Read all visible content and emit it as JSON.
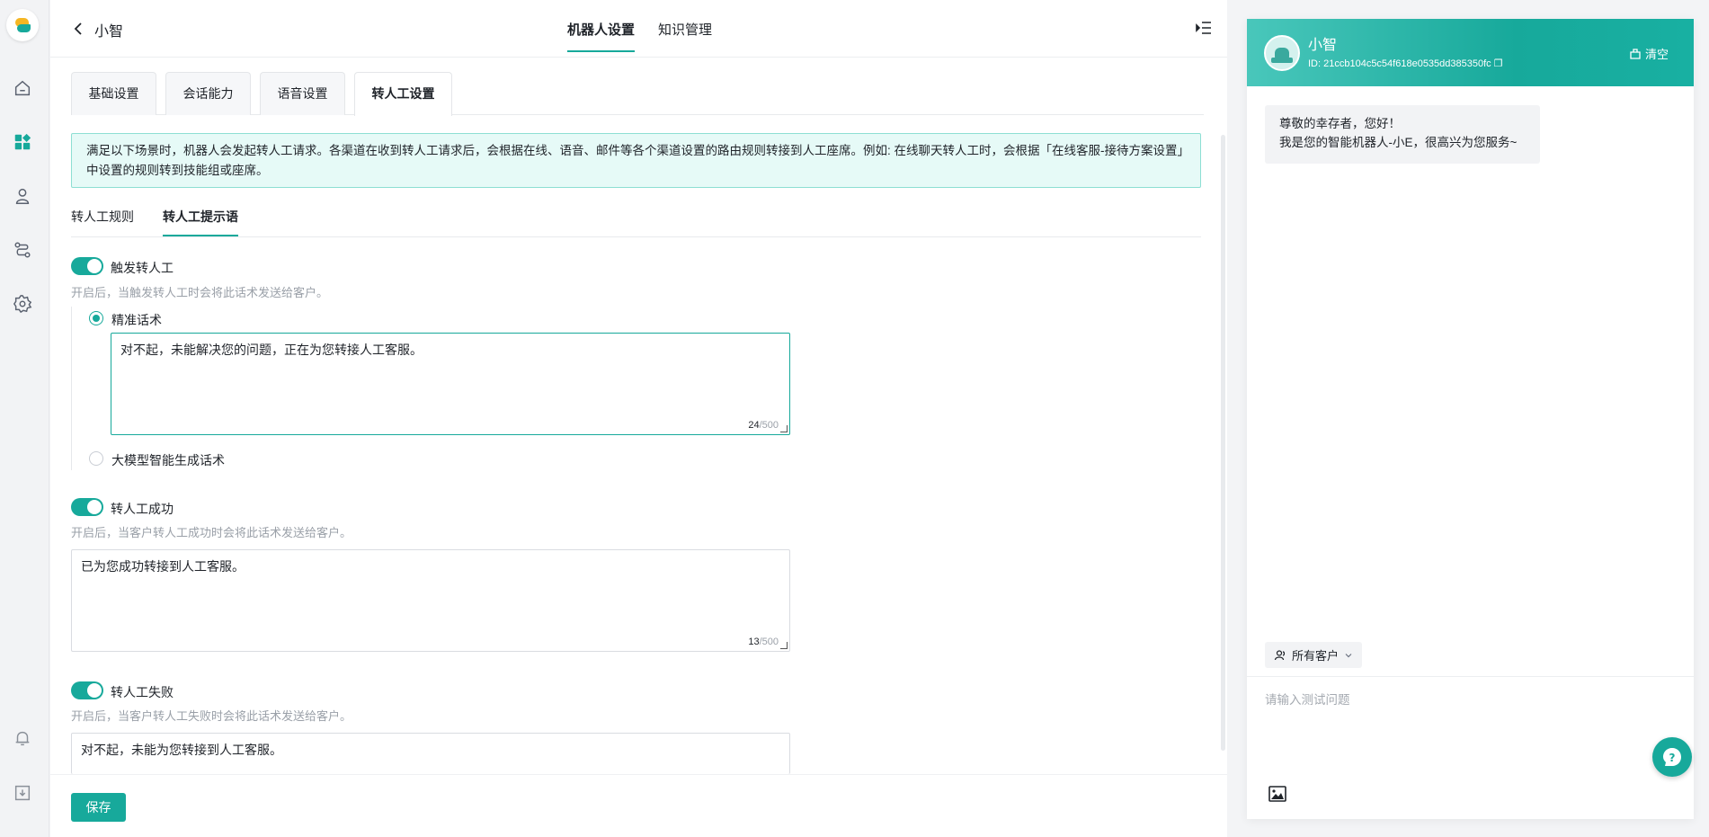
{
  "app": {
    "bot_name": "小智",
    "top_tabs": [
      "机器人设置",
      "知识管理"
    ],
    "top_active_tab": "机器人设置"
  },
  "subtabs": [
    "基础设置",
    "会话能力",
    "语音设置",
    "转人工设置"
  ],
  "notice": "满足以下场景时，机器人会发起转人工请求。各渠道在收到转人工请求后，会根据在线、语音、邮件等各个渠道设置的路由规则转接到人工座席。例如: 在线聊天转人工时，会根据「在线客服-接待方案设置」中设置的规则转到技能组或座席。",
  "inner_tabs": [
    "转人工规则",
    "转人工提示语"
  ],
  "trigger": {
    "title": "触发转人工",
    "enabled": true,
    "hint": "开启后，当触发转人工时会将此话术发送给客户。",
    "option1": "精准话术",
    "option2": "大模型智能生成话术",
    "text": "对不起，未能解决您的问题，正在为您转接人工客服。",
    "count": "24",
    "max": "/500"
  },
  "success": {
    "title": "转人工成功",
    "enabled": true,
    "hint": "开启后，当客户转人工成功时会将此话术发送给客户。",
    "text": "已为您成功转接到人工客服。",
    "count": "13",
    "max": "/500"
  },
  "fail": {
    "title": "转人工失败",
    "enabled": true,
    "hint": "开启后，当客户转人工失败时会将此话术发送给客户。",
    "text": "对不起，未能为您转接到人工客服。"
  },
  "footer": {
    "save_label": "保存"
  },
  "chat": {
    "name": "小智",
    "id": "ID: 21ccb104c5c54f618e0535dd385350fc",
    "clear_label": "清空",
    "greeting_line1": "尊敬的幸存者，您好！",
    "greeting_line2": "我是您的智能机器人-小E，很高兴为您服务~",
    "audience_label": "所有客户",
    "input_placeholder": "请输入测试问题"
  },
  "colors": {
    "accent": "#17a99b",
    "notice_bg": "#e6faf7"
  }
}
